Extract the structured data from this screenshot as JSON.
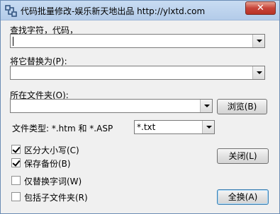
{
  "window": {
    "title": "代码批量修改-娱乐新天地出品 http://ylxtd.com",
    "close_glyph": "✕"
  },
  "find": {
    "label": "查找字符，代码，",
    "value": ""
  },
  "replace": {
    "label": "将它替换为(P):",
    "value": ""
  },
  "folder": {
    "label": "所在文件夹(O):",
    "value": "",
    "browse_label": "浏览(B)"
  },
  "filetype": {
    "label": "文件类型: *.htm 和 *.ASP",
    "selected": "*.txt"
  },
  "options": [
    {
      "label": "区分大小写(C)",
      "checked": true
    },
    {
      "label": "保存备份(B)",
      "checked": true
    },
    {
      "label": "仅替换字词(W)",
      "checked": false
    },
    {
      "label": "包括子文件夹(R)",
      "checked": false
    }
  ],
  "buttons": {
    "close_label": "关闭(L)",
    "replace_all_label": "全换(A)"
  }
}
